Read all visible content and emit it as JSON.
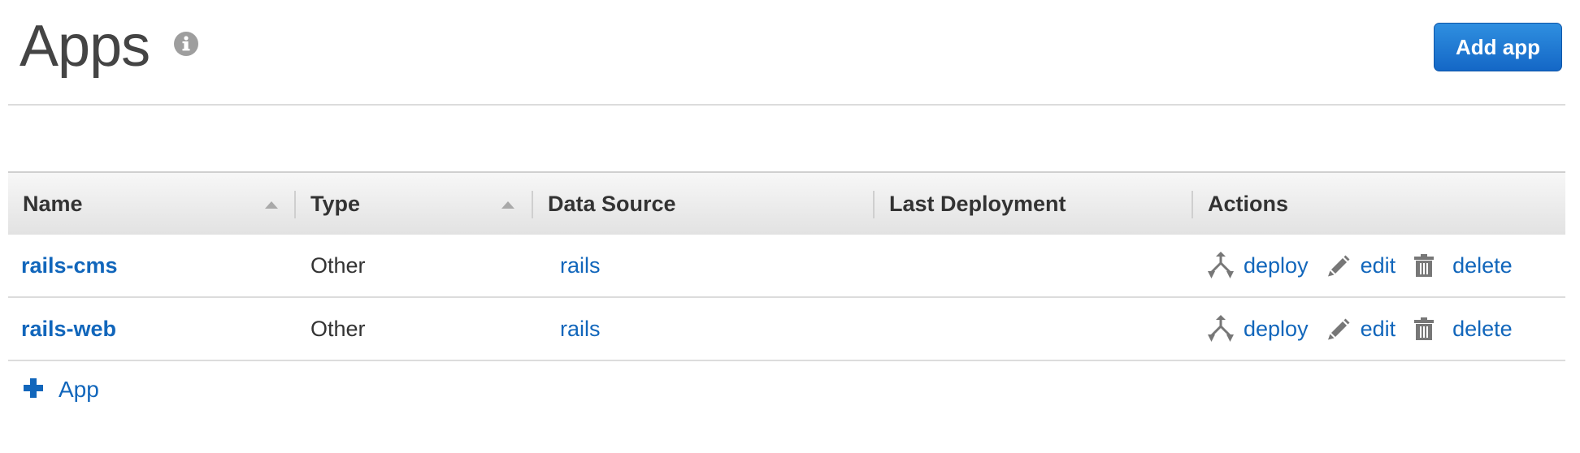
{
  "header": {
    "title": "Apps",
    "add_button_label": "Add app"
  },
  "table": {
    "columns": [
      {
        "label": "Name",
        "sortable": true
      },
      {
        "label": "Type",
        "sortable": true
      },
      {
        "label": "Data Source",
        "sortable": false
      },
      {
        "label": "Last Deployment",
        "sortable": false
      },
      {
        "label": "Actions",
        "sortable": false
      }
    ],
    "rows": [
      {
        "name": "rails-cms",
        "type": "Other",
        "data_source": "rails",
        "last_deployment": "",
        "actions": {
          "deploy": "deploy",
          "edit": "edit",
          "delete": "delete"
        }
      },
      {
        "name": "rails-web",
        "type": "Other",
        "data_source": "rails",
        "last_deployment": "",
        "actions": {
          "deploy": "deploy",
          "edit": "edit",
          "delete": "delete"
        }
      }
    ]
  },
  "footer": {
    "add_label": "App"
  },
  "icons": {
    "info": "info-icon",
    "deploy": "deploy-icon",
    "edit": "pencil-icon",
    "delete": "trash-icon",
    "add": "plus-icon"
  },
  "colors": {
    "link": "#1166bb",
    "primary_button": "#1a74d0",
    "icon_gray": "#777777",
    "header_bg": "#e8e8e8"
  }
}
